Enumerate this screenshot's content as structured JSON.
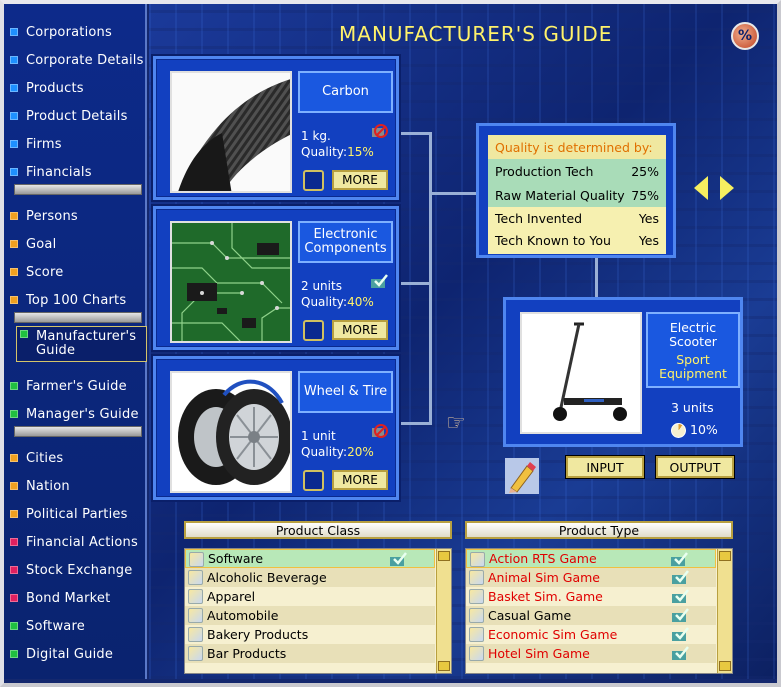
{
  "title": "MANUFACTURER'S GUIDE",
  "percent_icon": "%",
  "sidebar": {
    "groups": [
      [
        {
          "label": "Corporations",
          "color": "#1e90ff"
        },
        {
          "label": "Corporate Details",
          "color": "#1e90ff"
        },
        {
          "label": "Products",
          "color": "#1e90ff"
        },
        {
          "label": "Product Details",
          "color": "#1e90ff"
        },
        {
          "label": "Firms",
          "color": "#1e90ff"
        },
        {
          "label": "Financials",
          "color": "#1e90ff"
        }
      ],
      [
        {
          "label": "Persons",
          "color": "#f0a020"
        },
        {
          "label": "Goal",
          "color": "#f0a020"
        },
        {
          "label": "Score",
          "color": "#f0a020"
        },
        {
          "label": "Top 100 Charts",
          "color": "#f0a020"
        }
      ],
      [
        {
          "label": "Manufacturer's Guide",
          "color": "#20c040",
          "active": true
        },
        {
          "label": "Farmer's Guide",
          "color": "#20c040"
        },
        {
          "label": "Manager's Guide",
          "color": "#20c040"
        }
      ],
      [
        {
          "label": "Cities",
          "color": "#f0a020"
        },
        {
          "label": "Nation",
          "color": "#f0a020"
        },
        {
          "label": "Political Parties",
          "color": "#f0a020"
        },
        {
          "label": "Financial Actions",
          "color": "#e02060"
        },
        {
          "label": "Stock Exchange",
          "color": "#e02060"
        },
        {
          "label": "Bond Market",
          "color": "#e02060"
        },
        {
          "label": "Software",
          "color": "#20c040"
        },
        {
          "label": "Digital Guide",
          "color": "#20c040"
        }
      ]
    ]
  },
  "inputs": [
    {
      "name": "Carbon",
      "qty": "1 kg.",
      "quality_label": "Quality:",
      "quality": "15%",
      "more": "MORE",
      "icon": "no-factory-icon"
    },
    {
      "name": "Electronic Components",
      "qty": "2 units",
      "quality_label": "Quality:",
      "quality": "40%",
      "more": "MORE",
      "icon": "checkmark-building-icon"
    },
    {
      "name": "Wheel & Tire",
      "qty": "1 unit",
      "quality_label": "Quality:",
      "quality": "20%",
      "more": "MORE",
      "icon": "no-factory-icon"
    }
  ],
  "quality_box": {
    "heading": "Quality is determined by:",
    "rows": [
      {
        "label": "Production Tech",
        "value": "25%"
      },
      {
        "label": "Raw Material Quality",
        "value": "75%"
      },
      {
        "label": "Tech Invented",
        "value": "Yes"
      },
      {
        "label": "Tech Known to You",
        "value": "Yes"
      }
    ]
  },
  "product": {
    "name": "Electric Scooter",
    "category": "Sport Equipment",
    "units": "3 units",
    "percent": "10%"
  },
  "buttons": {
    "input": "INPUT",
    "output": "OUTPUT"
  },
  "product_class": {
    "header": "Product Class",
    "items": [
      "Software",
      "Alcoholic Beverage",
      "Apparel",
      "Automobile",
      "Bakery Products",
      "Bar Products"
    ],
    "selected": 0
  },
  "product_type": {
    "header": "Product Type",
    "items": [
      {
        "label": "Action RTS Game",
        "red": true
      },
      {
        "label": "Animal Sim Game",
        "red": true
      },
      {
        "label": "Basket Sim. Game",
        "red": true
      },
      {
        "label": "Casual Game",
        "red": false
      },
      {
        "label": "Economic Sim Game",
        "red": true
      },
      {
        "label": "Hotel Sim Game",
        "red": true
      }
    ],
    "selected": 0
  },
  "colors": {
    "accent_yellow": "#fff26a",
    "panel_blue": "#1240c0",
    "link_red": "#e00000"
  }
}
